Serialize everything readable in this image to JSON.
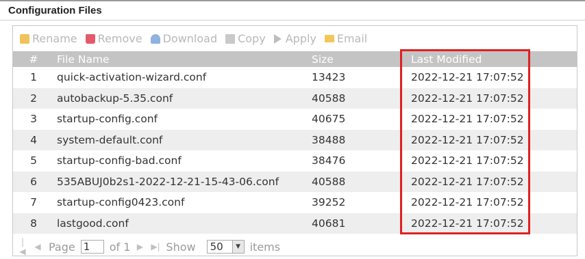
{
  "title": "Configuration Files",
  "toolbar": {
    "rename": "Rename",
    "remove": "Remove",
    "download": "Download",
    "copy": "Copy",
    "apply": "Apply",
    "email": "Email"
  },
  "table": {
    "headers": {
      "num": "#",
      "name": "File Name",
      "size": "Size",
      "modified": "Last Modified"
    },
    "rows": [
      {
        "num": "1",
        "name": "quick-activation-wizard.conf",
        "size": "13423",
        "modified": "2022-12-21 17:07:52"
      },
      {
        "num": "2",
        "name": "autobackup-5.35.conf",
        "size": "40588",
        "modified": "2022-12-21 17:07:52"
      },
      {
        "num": "3",
        "name": "startup-config.conf",
        "size": "40675",
        "modified": "2022-12-21 17:07:52"
      },
      {
        "num": "4",
        "name": "system-default.conf",
        "size": "38488",
        "modified": "2022-12-21 17:07:52"
      },
      {
        "num": "5",
        "name": "startup-config-bad.conf",
        "size": "38476",
        "modified": "2022-12-21 17:07:52"
      },
      {
        "num": "6",
        "name": "535ABUJ0b2s1-2022-12-21-15-43-06.conf",
        "size": "40588",
        "modified": "2022-12-21 17:07:52"
      },
      {
        "num": "7",
        "name": "startup-config0423.conf",
        "size": "39252",
        "modified": "2022-12-21 17:07:52"
      },
      {
        "num": "8",
        "name": "lastgood.conf",
        "size": "40681",
        "modified": "2022-12-21 17:07:52"
      }
    ]
  },
  "pager": {
    "page_label": "Page",
    "page_value": "1",
    "of_label": "of 1",
    "show_label": "Show",
    "show_value": "50",
    "items_label": "items"
  },
  "colors": {
    "highlight": "#e02020",
    "header_bg": "#c4c4c4"
  }
}
